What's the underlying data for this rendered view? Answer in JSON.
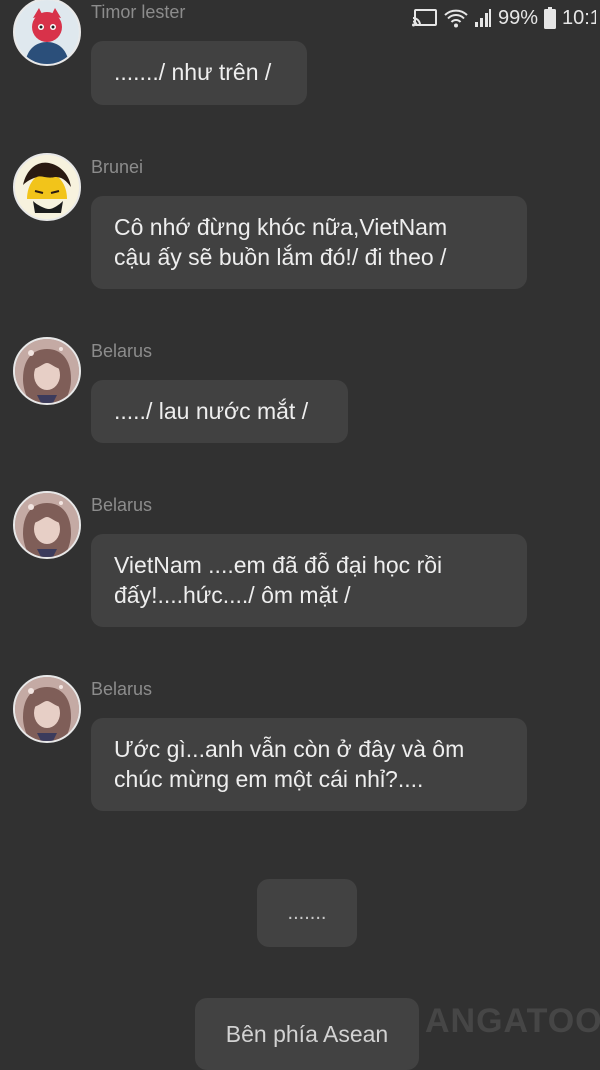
{
  "status": {
    "battery_percent": "99%",
    "time": "10:1"
  },
  "messages": [
    {
      "sender": "Timor lester",
      "avatar_icon": "timor-leste-avatar-icon",
      "text": "......./ như trên /"
    },
    {
      "sender": "Brunei",
      "avatar_icon": "brunei-avatar-icon",
      "text_line1": "Cô nhớ đừng khóc nữa,VietNam",
      "text_line2": "cậu ấy sẽ buồn lắm đó!/ đi theo /"
    },
    {
      "sender": "Belarus",
      "avatar_icon": "belarus-avatar-icon",
      "text": "...../ lau nước mắt /"
    },
    {
      "sender": "Belarus",
      "avatar_icon": "belarus-avatar-icon",
      "text_line1": "VietNam ....em đã đỗ đại học rồi",
      "text_line2": "đấy!....hức..../ ôm mặt /"
    },
    {
      "sender": "Belarus",
      "avatar_icon": "belarus-avatar-icon",
      "text_line1": "Ước gì...anh vẫn còn ở đây và ôm",
      "text_line2": "chúc mừng em một cái nhỉ?...."
    }
  ],
  "narration": ".......",
  "scene_label": "Bên phía Asean",
  "watermark": "ANGATOON",
  "colors": {
    "background": "#313131",
    "bubble": "#414141",
    "sender_name": "#8c8c8c",
    "text": "#eeeeee"
  }
}
